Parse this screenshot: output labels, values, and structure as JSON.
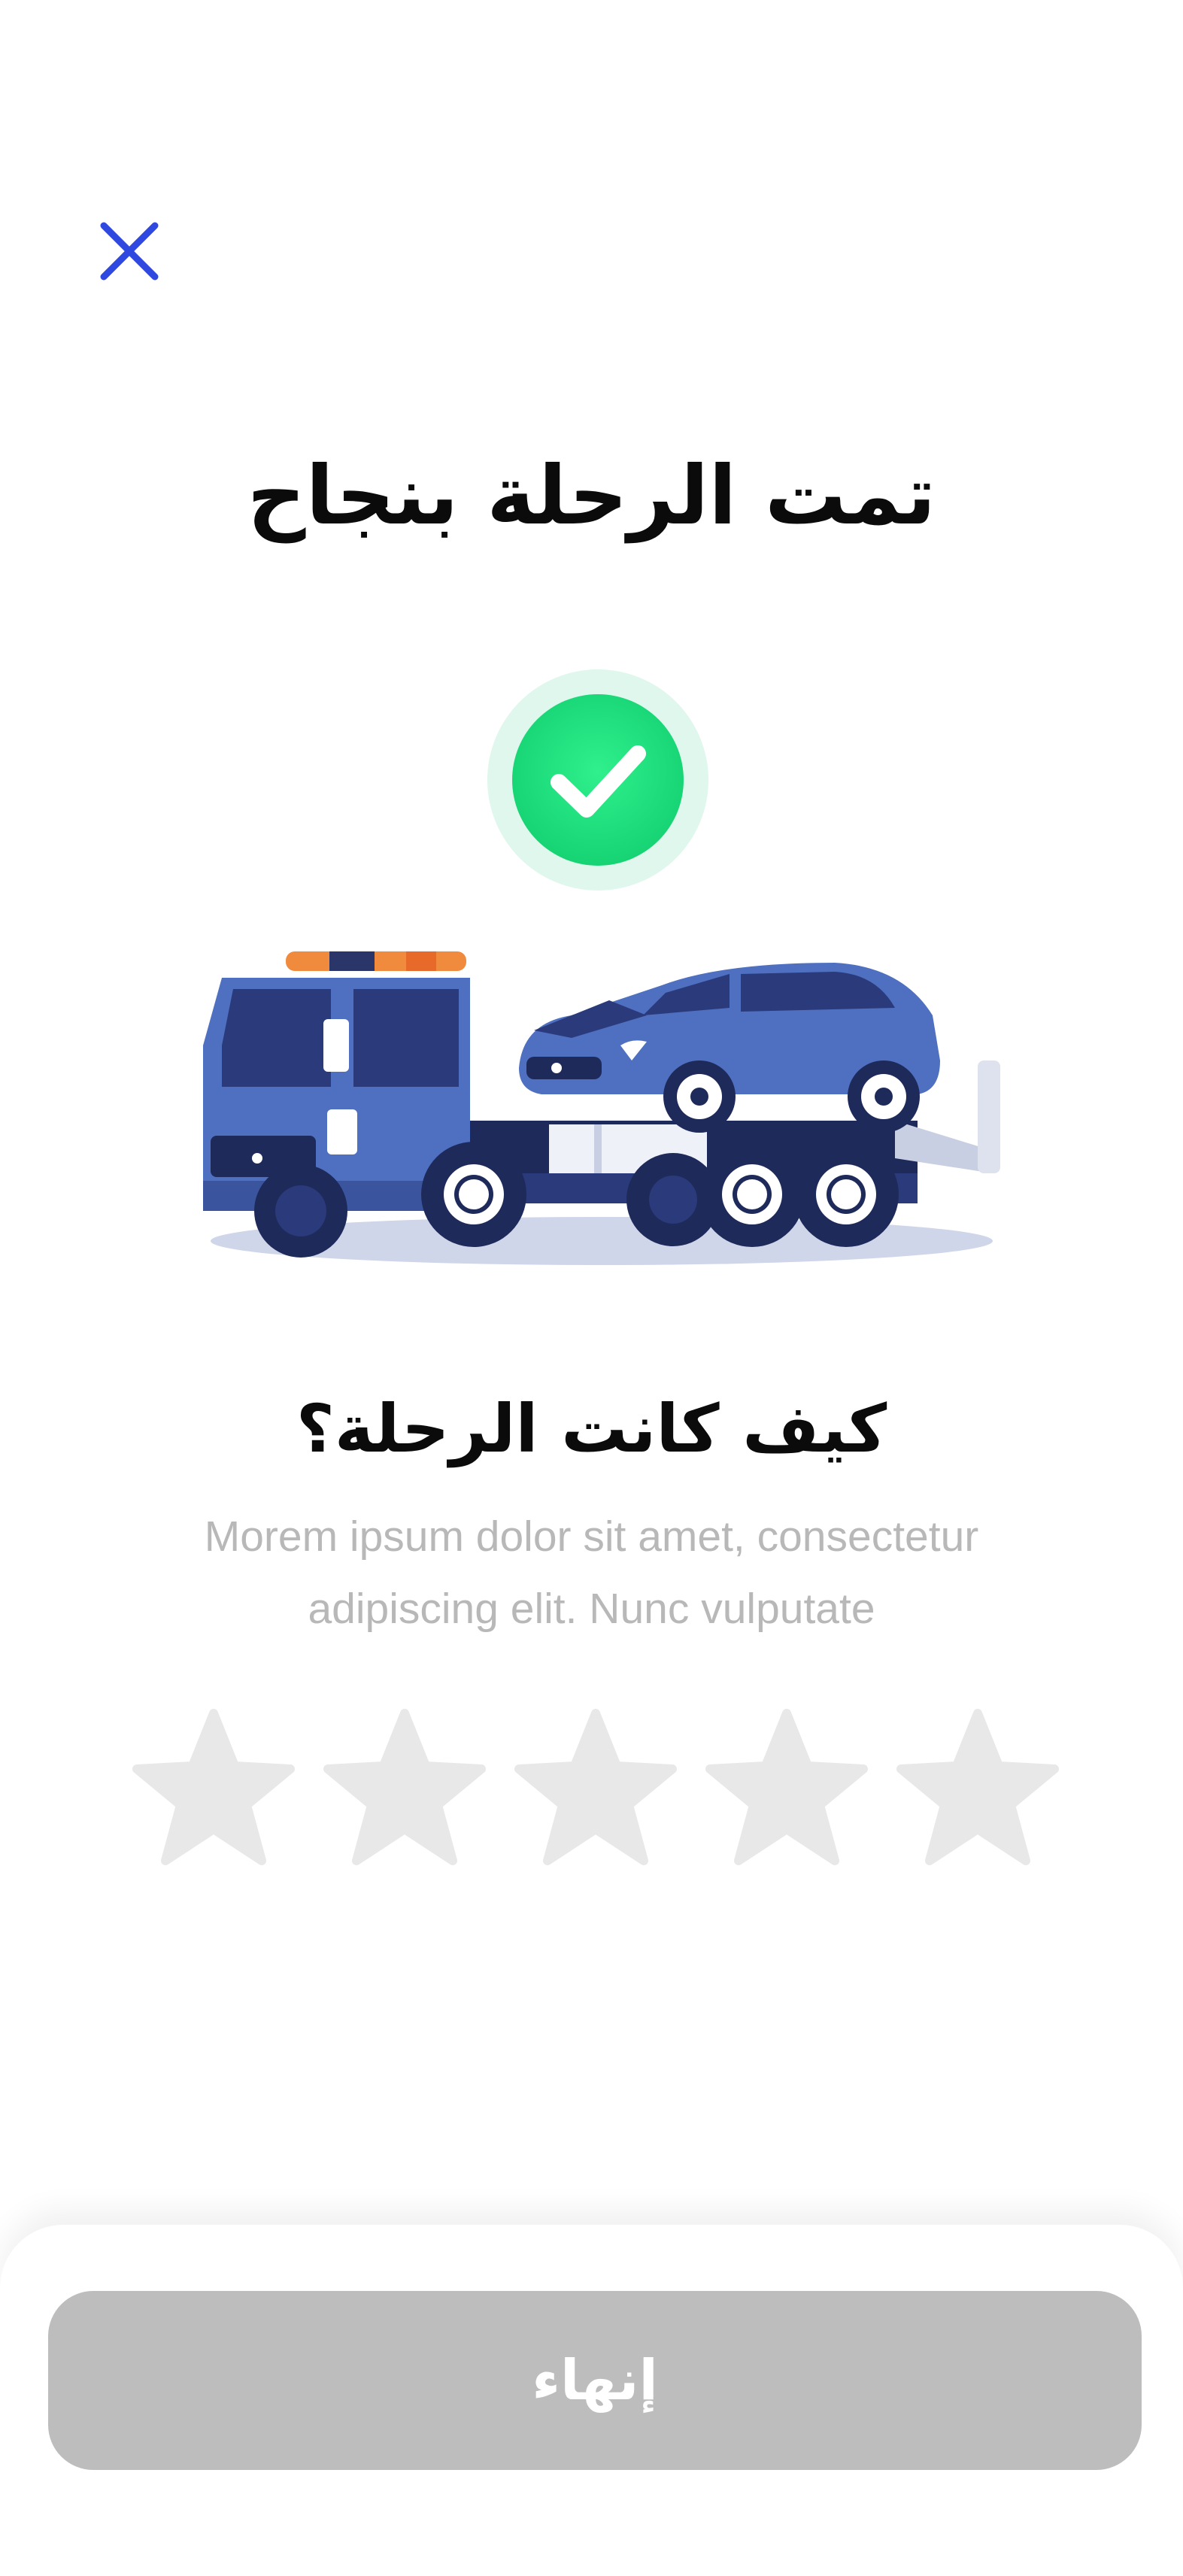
{
  "header": {
    "close_icon": "close-icon",
    "close_color": "#2f49e0"
  },
  "main": {
    "title": "تمت الرحلة بنجاح",
    "success_icon": "check-circle-icon",
    "success_color": "#1fd97a",
    "illustration": "tow-truck-illustration",
    "question": "كيف كانت الرحلة؟",
    "description": "Morem ipsum dolor sit amet, consectetur adipiscing elit. Nunc vulputate"
  },
  "rating": {
    "max_stars": 5,
    "selected": 0,
    "star_icon": "star-icon",
    "empty_color": "#e8e8e8"
  },
  "footer": {
    "finish_label": "إنهاء",
    "button_color": "#bdbdbd"
  }
}
